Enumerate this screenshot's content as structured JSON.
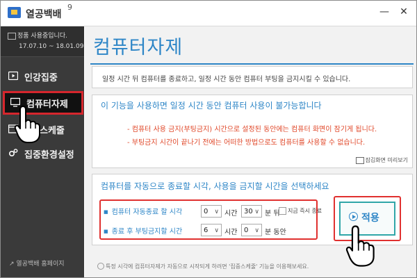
{
  "window": {
    "app_title": "열공백배",
    "version": "9",
    "minimize": "—",
    "close": "✕"
  },
  "sidebar": {
    "trial_text": "정품 사용중입니다.",
    "trial_dates": "17.07.10 ~ 18.01.09",
    "items": [
      {
        "label": "인강집중",
        "icon": "play-icon"
      },
      {
        "label": "컴퓨터자제",
        "icon": "monitor-icon"
      },
      {
        "label": "스케줄",
        "icon": "calendar-icon"
      },
      {
        "label": "집중환경설정",
        "icon": "gear-icon"
      }
    ],
    "homepage": "열공백배 홈페이지"
  },
  "main": {
    "title": "컴퓨터자제",
    "description": "일정 시간 뒤 컴퓨터를 종료하고, 일정 시간 동안 컴퓨터 부팅을 금지시킬 수 있습니다.",
    "warning": {
      "title": "이 기능을 사용하면 일정 시간 동안 컴퓨터 사용이 불가능합니다",
      "line1": "- 컴퓨터 사용 금지(부팅금지) 시간으로 설정된 동안에는 컴퓨터 화면이 잠기게 됩니다.",
      "line2": "- 부팅금지 시간이 끝나기 전에는 어떠한 방법으로도 컴퓨터를 사용할 수 없습니다.",
      "preview": "잠김화면 미리보기"
    },
    "settings": {
      "title": "컴퓨터를 자동으로 종료할 시각, 사용을 금지할 시간을 선택하세요",
      "row1": {
        "label": "컴퓨터 자동종료 할 시각",
        "hours": "0",
        "hour_unit": "시간",
        "minutes": "30",
        "minute_unit": "분 뒤",
        "immediate": "지금 즉시 종료"
      },
      "row2": {
        "label": "종료 후 부팅금지할 시간",
        "hours": "6",
        "hour_unit": "시간",
        "minutes": "0",
        "minute_unit": "분 동안"
      },
      "apply": "적용"
    },
    "footnote": "특정 시각에 컴퓨터자제가 자동으로 시작되게 하려면 '집중스케줄' 기능을 이용해보세요."
  },
  "colors": {
    "accent": "#2e86c7",
    "highlight": "#e0302f",
    "warning": "#e0482a",
    "sidebar": "#3a3a3a"
  }
}
